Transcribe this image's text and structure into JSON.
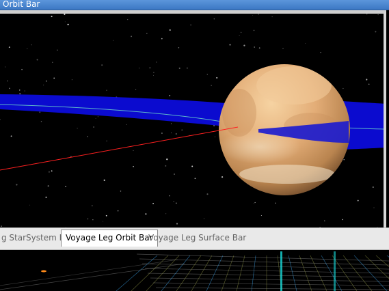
{
  "window": {
    "title": "Orbit Bar"
  },
  "tabs": [
    {
      "label": "g StarSystem Bar",
      "active": false
    },
    {
      "label": "Voyage Leg Orbit Bar",
      "active": true
    },
    {
      "label": "Voyage Leg Surface Bar",
      "active": false
    }
  ],
  "colors": {
    "titlebar": "#4a86d1",
    "orbit_plane": "#0a0ad8",
    "trajectory": "#ff1a1a",
    "planet": "#e7b27a"
  }
}
